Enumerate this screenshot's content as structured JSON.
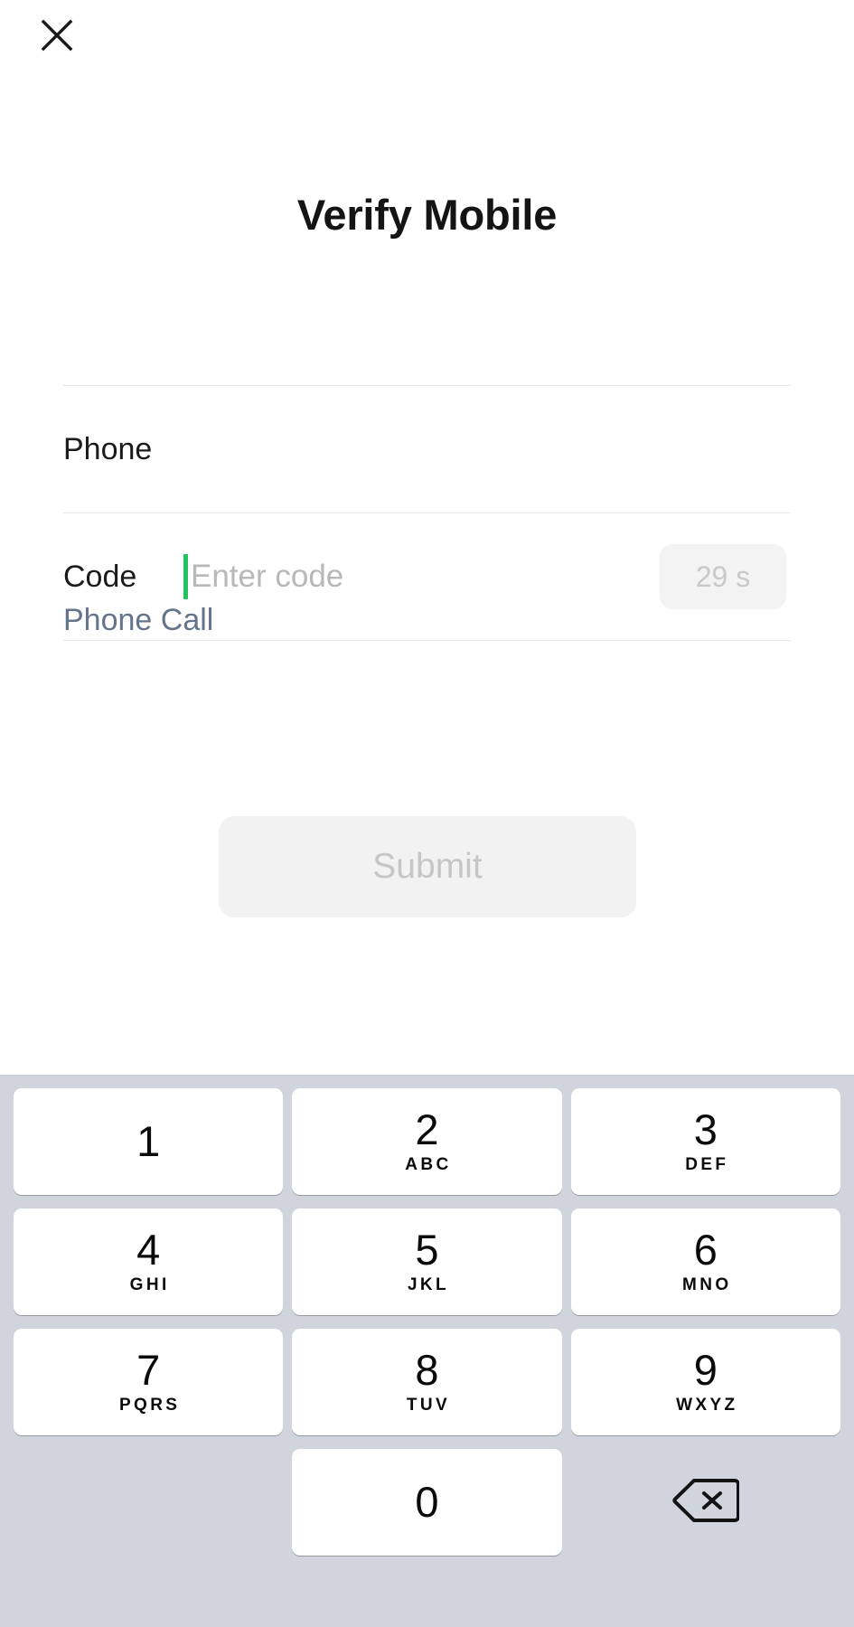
{
  "header": {
    "close_icon": "close-icon",
    "title": "Verify Mobile"
  },
  "form": {
    "phone": {
      "label": "Phone",
      "value": ""
    },
    "code": {
      "label": "Code",
      "placeholder": "Enter code",
      "value": "",
      "caret_color": "#21c45d"
    },
    "timer": {
      "label": "29 s",
      "seconds": 29,
      "enabled": false
    },
    "alt_link": {
      "label": "Phone Call",
      "color": "#64748b"
    },
    "submit": {
      "label": "Submit",
      "enabled": false,
      "bg": "#f2f2f2",
      "text_color": "#c6c6c6"
    }
  },
  "keypad": {
    "background": "#d0d4dc",
    "key_background": "#ffffff",
    "rows": [
      [
        {
          "digit": "1",
          "letters": ""
        },
        {
          "digit": "2",
          "letters": "ABC"
        },
        {
          "digit": "3",
          "letters": "DEF"
        }
      ],
      [
        {
          "digit": "4",
          "letters": "GHI"
        },
        {
          "digit": "5",
          "letters": "JKL"
        },
        {
          "digit": "6",
          "letters": "MNO"
        }
      ],
      [
        {
          "digit": "7",
          "letters": "PQRS"
        },
        {
          "digit": "8",
          "letters": "TUV"
        },
        {
          "digit": "9",
          "letters": "WXYZ"
        }
      ],
      [
        {
          "digit": "",
          "letters": "",
          "type": "blank"
        },
        {
          "digit": "0",
          "letters": "",
          "type": "key"
        },
        {
          "digit": "",
          "letters": "",
          "type": "backspace",
          "icon": "backspace-icon"
        }
      ]
    ]
  }
}
